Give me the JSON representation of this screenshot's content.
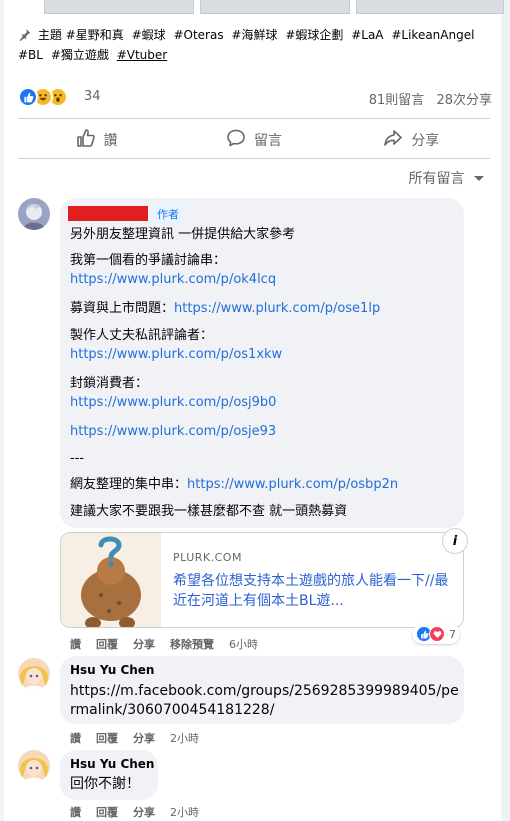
{
  "post": {
    "topics_label": "主題",
    "tags": [
      "#星野和真",
      "#蝦球",
      "#Oteras",
      "#海鮮球",
      "#蝦球企劃",
      "#LaA",
      "#LikeanAngel",
      "#BL",
      "#獨立遊戲",
      "#Vtuber"
    ],
    "reaction_count": "34",
    "comment_count": "81則留言",
    "share_count": "28次分享"
  },
  "actions": {
    "like_label": "讚",
    "comment_label": "留言",
    "share_label": "分享"
  },
  "sort_label": "所有留言",
  "comments": {
    "first": {
      "author_badge": "作者",
      "intro": "另外朋友整理資訊 一併提供給大家參考",
      "l1_label": "我第一個看的爭議討論串：",
      "l1_url": "https://www.plurk.com/p/ok4lcq",
      "l2_label": "募資與上市問題：",
      "l2_url": "https://www.plurk.com/p/ose1lp",
      "l3_label": "製作人丈夫私訊評論者：",
      "l3_url": "https://www.plurk.com/p/os1xkw",
      "l4_label": "封鎖消費者：",
      "l4_url1": "https://www.plurk.com/p/osj9b0",
      "l4_url2": "https://www.plurk.com/p/osje93",
      "sep": "---",
      "l5_label": "網友整理的集中串：",
      "l5_url": "https://www.plurk.com/p/osbp2n",
      "closing": "建議大家不要跟我一樣甚麼都不查 就一頭熱募資",
      "preview_domain": "PLURK.COM",
      "preview_title": "希望各位想支持本土遊戲的旅人能看一下//最近在河道上有個本土BL遊...",
      "like": "讚",
      "reply": "回覆",
      "share": "分享",
      "remove_preview": "移除預覽",
      "time": "6小時",
      "reactions": "7"
    },
    "second": {
      "author": "Hsu Yu Chen",
      "text": "https://m.facebook.com/groups/2569285399989405/permalink/3060700454181228/",
      "like": "讚",
      "reply": "回覆",
      "share": "分享",
      "time": "2小時"
    },
    "third": {
      "author": "Hsu Yu Chen",
      "text": "回你不謝！",
      "like": "讚",
      "reply": "回覆",
      "share": "分享",
      "time": "2小時"
    }
  }
}
